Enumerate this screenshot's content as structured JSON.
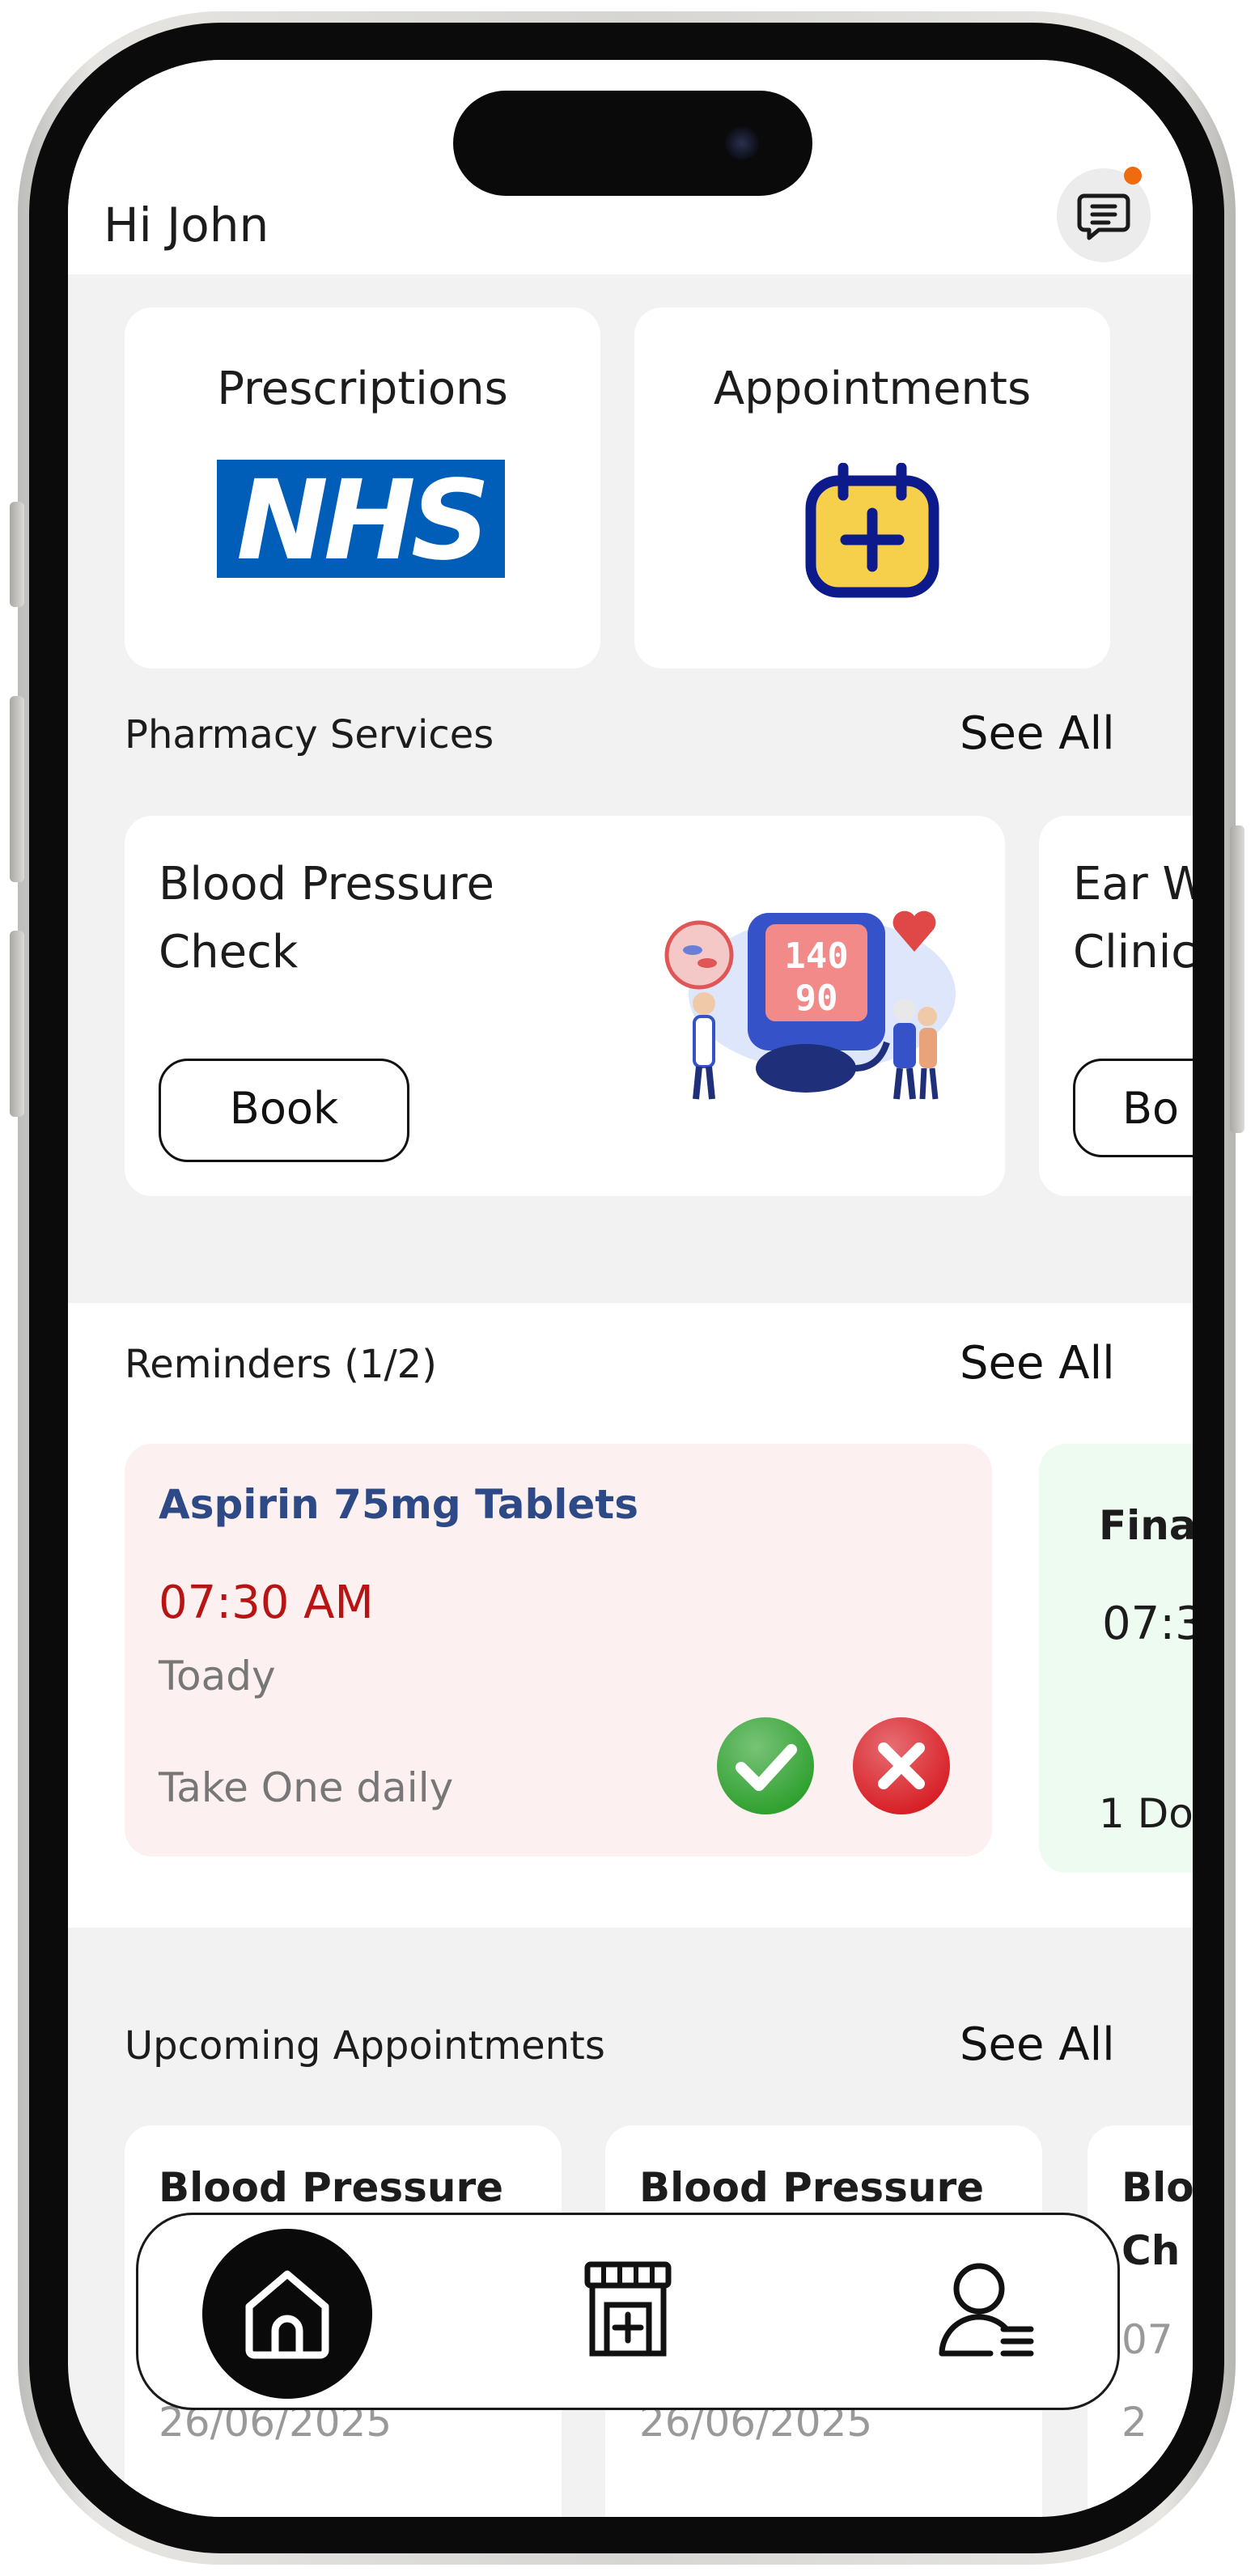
{
  "header": {
    "greeting": "Hi John"
  },
  "quick_actions": [
    {
      "label": "Prescriptions",
      "logo_text": "NHS",
      "logo_color": "#005EB8"
    },
    {
      "label": "Appointments",
      "icon": "calendar-plus-icon",
      "icon_color": "#F7D04B"
    }
  ],
  "pharmacy_services": {
    "title": "Pharmacy Services",
    "see_all": "See All",
    "items": [
      {
        "title": "Blood Pressure Check",
        "title_line1": "Blood Pressure",
        "title_line2": "Check",
        "button": "Book",
        "display_top": "140",
        "display_bottom": "90"
      },
      {
        "title_line1": "Ear W",
        "title_line2": "Clinic",
        "button": "Bo"
      }
    ]
  },
  "reminders": {
    "title": "Reminders (1/2)",
    "see_all": "See All",
    "items": [
      {
        "name": "Aspirin 75mg Tablets",
        "time": "07:30 AM",
        "day": "Toady",
        "instruction": "Take One daily",
        "bg": "#FDF0F0"
      },
      {
        "name": "Fina",
        "time": "07:3",
        "instruction": "1 Do",
        "bg": "#EEFBF0"
      }
    ]
  },
  "upcoming_appointments": {
    "title": "Upcoming Appointments",
    "see_all": "See All",
    "items": [
      {
        "title": "Blood Pressure",
        "date": "26/06/2025"
      },
      {
        "title": "Blood Pressure",
        "date": "26/06/2025"
      },
      {
        "title_line1": "Blo",
        "title_line2": "Ch",
        "time": "07",
        "date": "2"
      }
    ]
  },
  "nav": {
    "items": [
      {
        "name": "home-icon",
        "active": true
      },
      {
        "name": "pharmacy-store-icon",
        "active": false
      },
      {
        "name": "profile-menu-icon",
        "active": false
      }
    ]
  },
  "colors": {
    "accent_dark": "#0A0A0A",
    "notification": "#F06A10",
    "confirm": "#2FA12F",
    "dismiss": "#D81F26"
  }
}
